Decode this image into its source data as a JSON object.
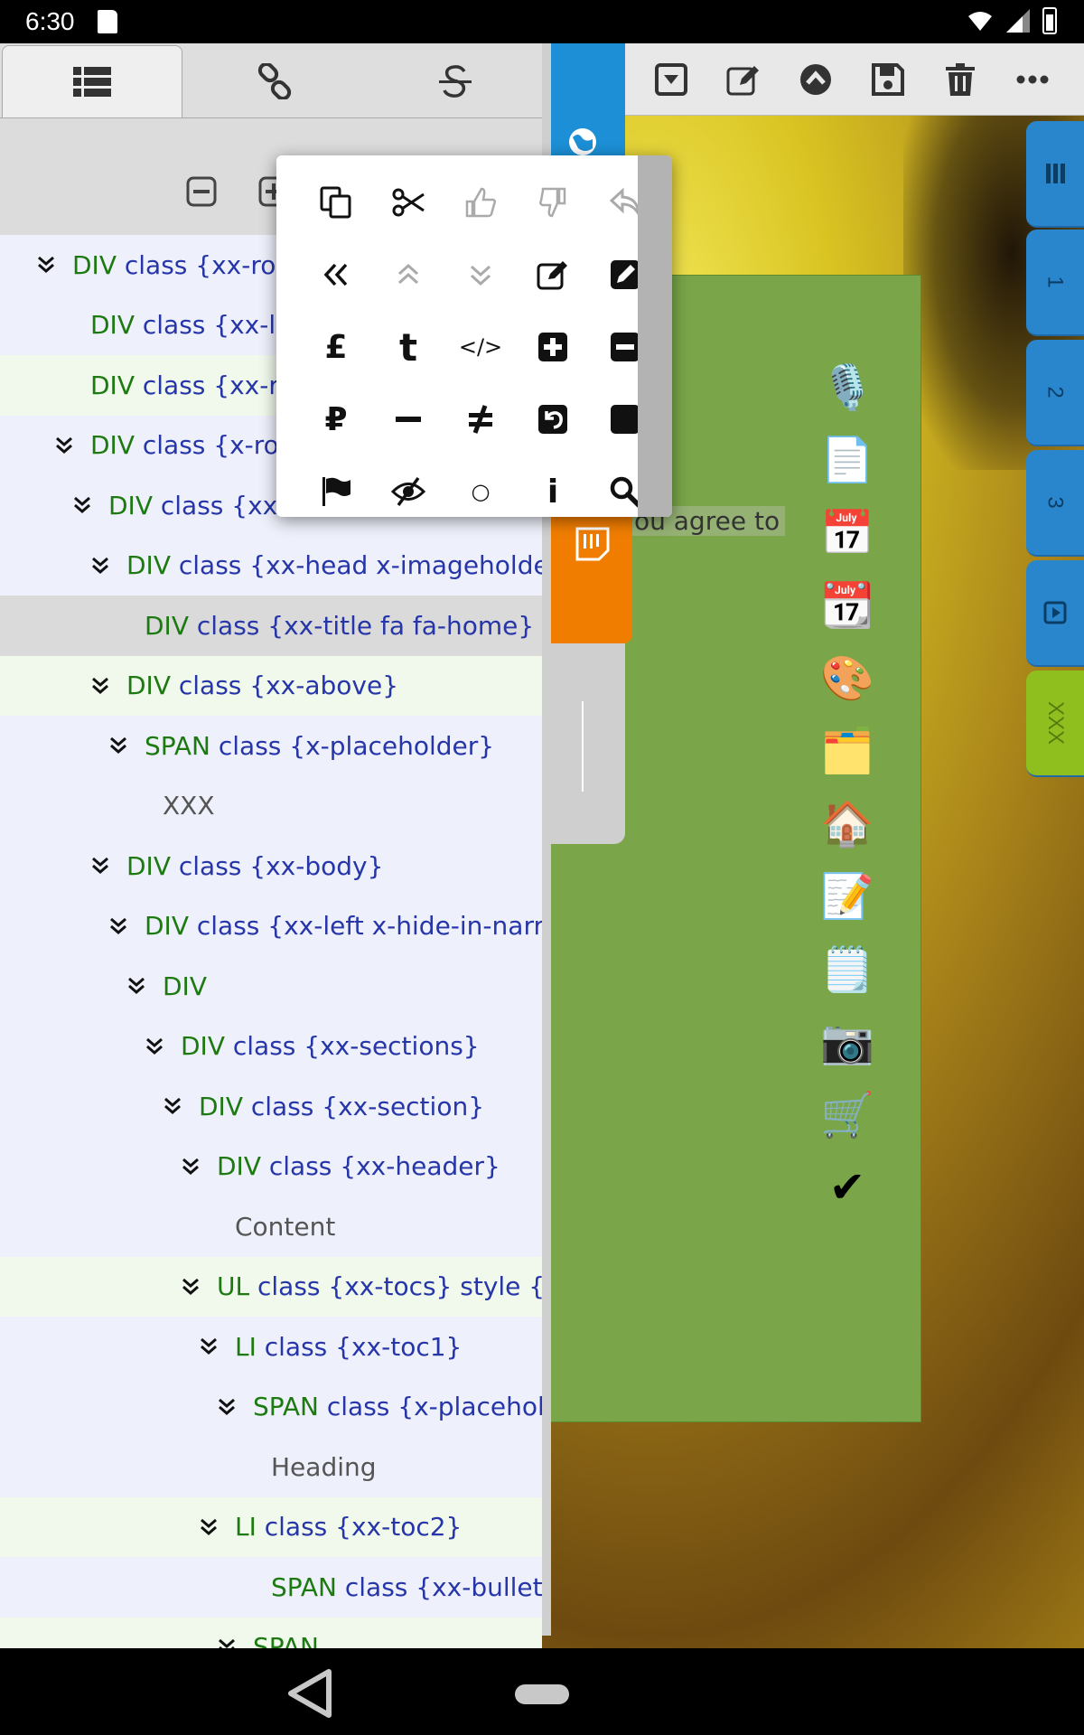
{
  "status_bar": {
    "time": "6:30"
  },
  "tree": [
    {
      "depth": 0,
      "chev": true,
      "tag": "DIV",
      "attr": " class {xx-roo",
      "style": ""
    },
    {
      "depth": 1,
      "chev": false,
      "tag": "DIV",
      "attr": " class {xx-le",
      "style": ""
    },
    {
      "depth": 1,
      "chev": false,
      "tag": "DIV",
      "attr": " class {xx-ri",
      "style": "alt"
    },
    {
      "depth": 1,
      "chev": true,
      "tag": "DIV",
      "attr": " class {x-ro",
      "style": ""
    },
    {
      "depth": 2,
      "chev": true,
      "tag": "DIV",
      "attr": " class {xx-",
      "style": ""
    },
    {
      "depth": 3,
      "chev": true,
      "tag": "DIV",
      "attr": " class {xx-head x-imageholder",
      "style": ""
    },
    {
      "depth": 4,
      "chev": false,
      "tag": "DIV",
      "attr": " class {xx-title fa fa-home}",
      "style": "sel"
    },
    {
      "depth": 3,
      "chev": true,
      "tag": "DIV",
      "attr": " class {xx-above}",
      "style": "alt"
    },
    {
      "depth": 4,
      "chev": true,
      "tag": "SPAN",
      "attr": " class {x-placeholder}",
      "style": ""
    },
    {
      "depth": 5,
      "chev": false,
      "text": "XXX",
      "style": ""
    },
    {
      "depth": 3,
      "chev": true,
      "tag": "DIV",
      "attr": " class {xx-body}",
      "style": ""
    },
    {
      "depth": 4,
      "chev": true,
      "tag": "DIV",
      "attr": " class {xx-left x-hide-in-narro",
      "style": ""
    },
    {
      "depth": 5,
      "chev": true,
      "tag": "DIV",
      "attr": "",
      "style": ""
    },
    {
      "depth": 6,
      "chev": true,
      "tag": "DIV",
      "attr": " class {xx-sections}",
      "style": ""
    },
    {
      "depth": 7,
      "chev": true,
      "tag": "DIV",
      "attr": " class {xx-section}",
      "style": ""
    },
    {
      "depth": 8,
      "chev": true,
      "tag": "DIV",
      "attr": " class {xx-header}",
      "style": ""
    },
    {
      "depth": 9,
      "chev": false,
      "text": "Content",
      "style": ""
    },
    {
      "depth": 8,
      "chev": true,
      "tag": "UL",
      "attr": " class {xx-tocs} style {lis",
      "style": "alt"
    },
    {
      "depth": 9,
      "chev": true,
      "tag": "LI",
      "attr": " class {xx-toc1}",
      "style": ""
    },
    {
      "depth": 10,
      "chev": true,
      "tag": "SPAN",
      "attr": " class {x-placehold",
      "style": ""
    },
    {
      "depth": 11,
      "chev": false,
      "text": "Heading",
      "style": ""
    },
    {
      "depth": 9,
      "chev": true,
      "tag": "LI",
      "attr": " class {xx-toc2}",
      "style": "alt"
    },
    {
      "depth": 11,
      "chev": false,
      "tag": "SPAN",
      "attr": " class {xx-bullet}",
      "style": ""
    },
    {
      "depth": 10,
      "chev": true,
      "tag": "SPAN",
      "attr": "",
      "style": "alt"
    }
  ],
  "green_panel": {
    "partial_text": "ou agree to"
  },
  "side_tabs": [
    "1",
    "2",
    "3",
    "XXX"
  ],
  "popup_icons": [
    [
      "copy-icon",
      "scissors-icon",
      "thumbs-up-icon",
      "thumbs-down-icon",
      "reply-icon"
    ],
    [
      "double-left-icon",
      "up-chevrons-icon",
      "down-chevrons-icon",
      "edit-icon",
      "pencil-square-icon"
    ],
    [
      "pound-icon",
      "tumblr-icon",
      "code-icon",
      "plus-square-icon",
      "minus-square-icon"
    ],
    [
      "ruble-icon",
      "minus-icon",
      "not-equal-icon",
      "undo-square-icon",
      "square-icon"
    ],
    [
      "flag-icon",
      "eye-slash-icon",
      "circle-icon",
      "info-icon",
      "search-icon"
    ]
  ],
  "popup_glyphs": {
    "pound": "£",
    "tumblr": "t",
    "ruble": "₽",
    "info": "i",
    "circle": "○",
    "code": "</>"
  },
  "emoji_column": [
    "🎙️",
    "📄",
    "📅",
    "📆",
    "🎨",
    "🗂️",
    "🏠",
    "📝",
    "🗒️",
    "📷",
    "🛒",
    "✔"
  ],
  "colors": {
    "blue_accent": "#1c8fd6",
    "orange_accent": "#f07d00",
    "tag_green": "#1c7a10",
    "attr_blue": "#2636a8",
    "green_panel": "#7aa548"
  }
}
